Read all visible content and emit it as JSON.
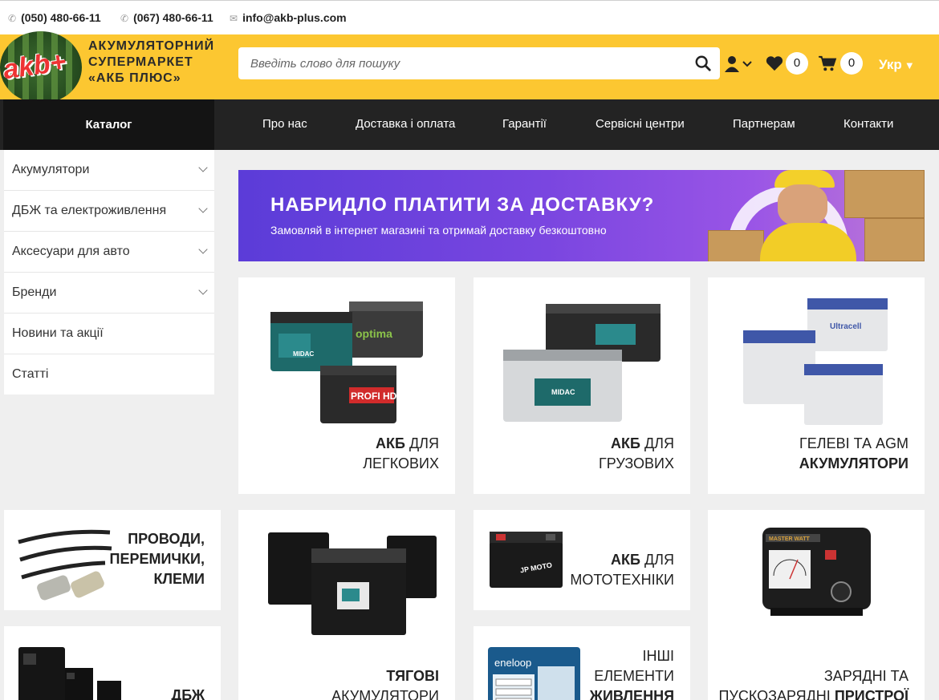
{
  "contacts": {
    "phone1": "(050) 480-66-11",
    "phone2": "(067) 480-66-11",
    "email": "info@akb-plus.com"
  },
  "header": {
    "logo_word": "akb+",
    "logo_line1": "АКУМУЛЯТОРНИЙ",
    "logo_line2": "СУПЕРМАРКЕТ",
    "logo_line3": "«АКБ ПЛЮС»",
    "search_placeholder": "Введіть слово для пошуку",
    "wishlist_count": "0",
    "cart_count": "0",
    "language": "Укр"
  },
  "nav": {
    "catalog": "Каталог",
    "links": [
      "Про нас",
      "Доставка і оплата",
      "Гарантії",
      "Сервісні центри",
      "Партнерам",
      "Контакти"
    ]
  },
  "sidebar": {
    "items": [
      {
        "label": "Акумулятори"
      },
      {
        "label": "ДБЖ та електроживлення"
      },
      {
        "label": "Аксесуари для авто"
      },
      {
        "label": "Бренди"
      },
      {
        "label": "Новини та акції"
      },
      {
        "label": "Статті"
      }
    ]
  },
  "banner": {
    "title": "НАБРИДЛО ПЛАТИТИ ЗА ДОСТАВКУ?",
    "subtitle": "Замовляй в інтернет магазині та отримай доставку безкоштовно"
  },
  "cards": {
    "car": {
      "bold": "АКБ",
      "rest": "ДЛЯ",
      "line2": "ЛЕГКОВИХ"
    },
    "truck": {
      "bold": "АКБ",
      "rest": "ДЛЯ",
      "line2": "ГРУЗОВИХ"
    },
    "gel": {
      "line1": "ГЕЛЕВІ ТА AGM",
      "line2": "АКУМУЛЯТОРИ"
    },
    "wires": {
      "line1": "ПРОВОДИ,",
      "line2": "ПЕРЕМИЧКИ,",
      "line3": "КЛЕМИ"
    },
    "traction": {
      "line1": "ТЯГОВІ",
      "line2": "АКУМУЛЯТОРИ"
    },
    "moto": {
      "bold": "АКБ",
      "rest": "ДЛЯ",
      "line2": "МОТОТЕХНІКИ"
    },
    "charger": {
      "line1": "ЗАРЯДНІ ТА",
      "line2a": "ПУСКОЗАРЯДНІ",
      "line2b": "ПРИСТРОЇ"
    },
    "ups": {
      "line1": "ДБЖ"
    },
    "other": {
      "line1": "ІНШІ",
      "line2": "ЕЛЕМЕНТИ",
      "line3": "ЖИВЛЕННЯ"
    }
  },
  "product_labels": {
    "midac": "MIDAC",
    "optima": "optima",
    "profi": "PROFI HD",
    "ultracell": "Ultracell",
    "jp_moto": "JP MOTO",
    "eneloop": "eneloop",
    "master_watt": "MASTER WATT"
  }
}
